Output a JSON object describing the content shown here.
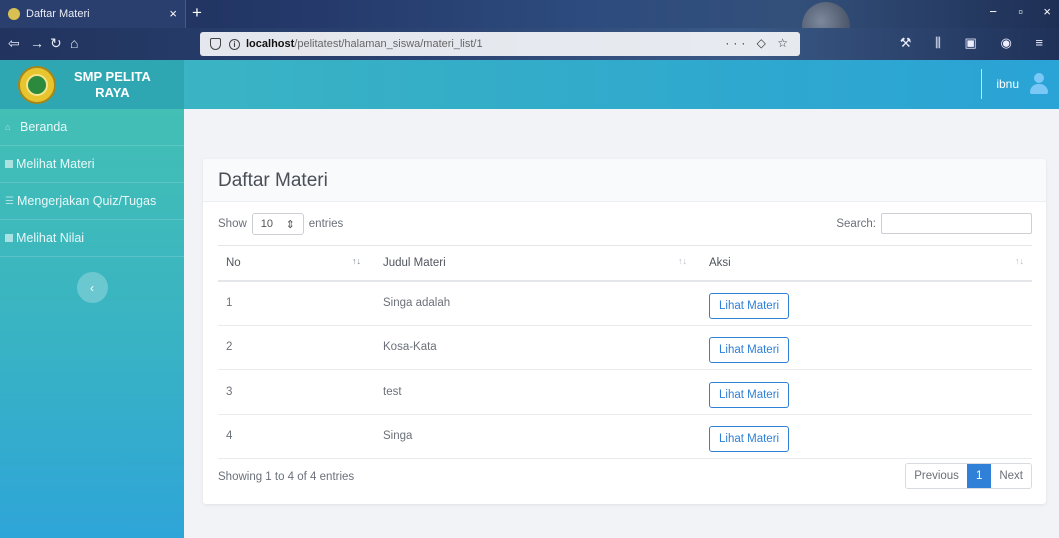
{
  "browser": {
    "tab_title": "Daftar Materi",
    "new_tab": "+",
    "url_host": "localhost",
    "url_path": "/pelitatest/halaman_siswa/materi_list/1"
  },
  "app": {
    "brand_line1": "SMP PELITA",
    "brand_line2": "RAYA",
    "username": "ibnu"
  },
  "sidebar": {
    "items": [
      {
        "label": "Beranda",
        "icon": "home-icon"
      },
      {
        "label": "Melihat Materi",
        "icon": "square-icon"
      },
      {
        "label": "Mengerjakan Quiz/Tugas",
        "icon": "list-icon"
      },
      {
        "label": "Melihat Nilai",
        "icon": "square-icon"
      }
    ],
    "toggle": "‹"
  },
  "card": {
    "title": "Daftar Materi",
    "show_label": "Show",
    "entries_value": "10",
    "entries_label": "entries",
    "search_label": "Search:",
    "columns": [
      "No",
      "Judul Materi",
      "Aksi"
    ],
    "rows": [
      {
        "no": "1",
        "judul": "Singa adalah",
        "aksi": "Lihat Materi"
      },
      {
        "no": "2",
        "judul": "Kosa-Kata",
        "aksi": "Lihat Materi"
      },
      {
        "no": "3",
        "judul": "test",
        "aksi": "Lihat Materi"
      },
      {
        "no": "4",
        "judul": "Singa",
        "aksi": "Lihat Materi"
      }
    ],
    "info": "Showing 1 to 4 of 4 entries",
    "pager": {
      "previous": "Previous",
      "current": "1",
      "next": "Next"
    }
  },
  "colors": {
    "accent": "#2f80d6",
    "header_teal": "#3fb9c3",
    "sidebar_teal": "#43bfb5"
  }
}
